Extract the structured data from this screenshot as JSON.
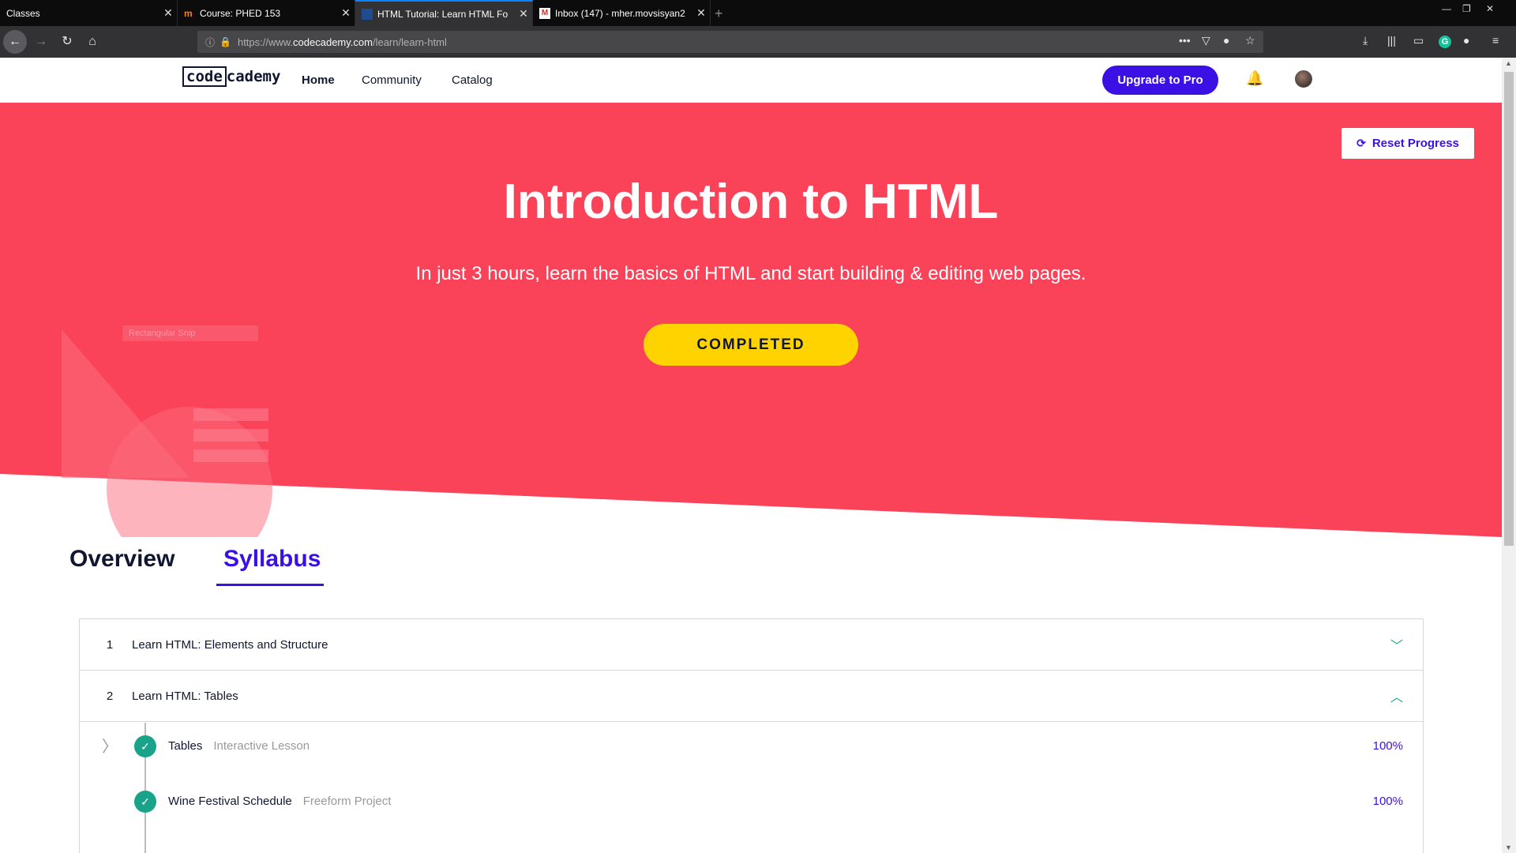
{
  "browser": {
    "tabs": [
      {
        "title": "Classes"
      },
      {
        "title": "Course: PHED 153"
      },
      {
        "title": "HTML Tutorial: Learn HTML Fo"
      },
      {
        "title": "Inbox (147) - mher.movsisyan2"
      }
    ],
    "url_prefix": "https://www.",
    "url_domain": "codecademy.com",
    "url_path": "/learn/learn-html"
  },
  "header": {
    "logo_code": "code",
    "logo_cademy": "cademy",
    "nav": [
      "Home",
      "Community",
      "Catalog"
    ],
    "upgrade_label": "Upgrade to Pro"
  },
  "hero": {
    "reset_label": "Reset Progress",
    "title": "Introduction to HTML",
    "subtitle": "In just 3 hours, learn the basics of HTML and start building & editing web pages.",
    "status_label": "COMPLETED",
    "snip_text": "Rectangular Snip",
    "bg_color": "#fa4359"
  },
  "tabs": {
    "overview": "Overview",
    "syllabus": "Syllabus"
  },
  "syllabus": {
    "units": [
      {
        "num": "1",
        "name": "Learn HTML: Elements and Structure",
        "expanded": false
      },
      {
        "num": "2",
        "name": "Learn HTML: Tables",
        "expanded": true
      }
    ],
    "lessons": [
      {
        "name": "Tables",
        "type": "Interactive Lesson",
        "progress": "100%"
      },
      {
        "name": "Wine Festival Schedule",
        "type": "Freeform Project",
        "progress": "100%"
      }
    ]
  },
  "colors": {
    "accent": "#3a10e5",
    "hero": "#fa4359",
    "completed": "#ffd300",
    "check": "#18a38a"
  }
}
